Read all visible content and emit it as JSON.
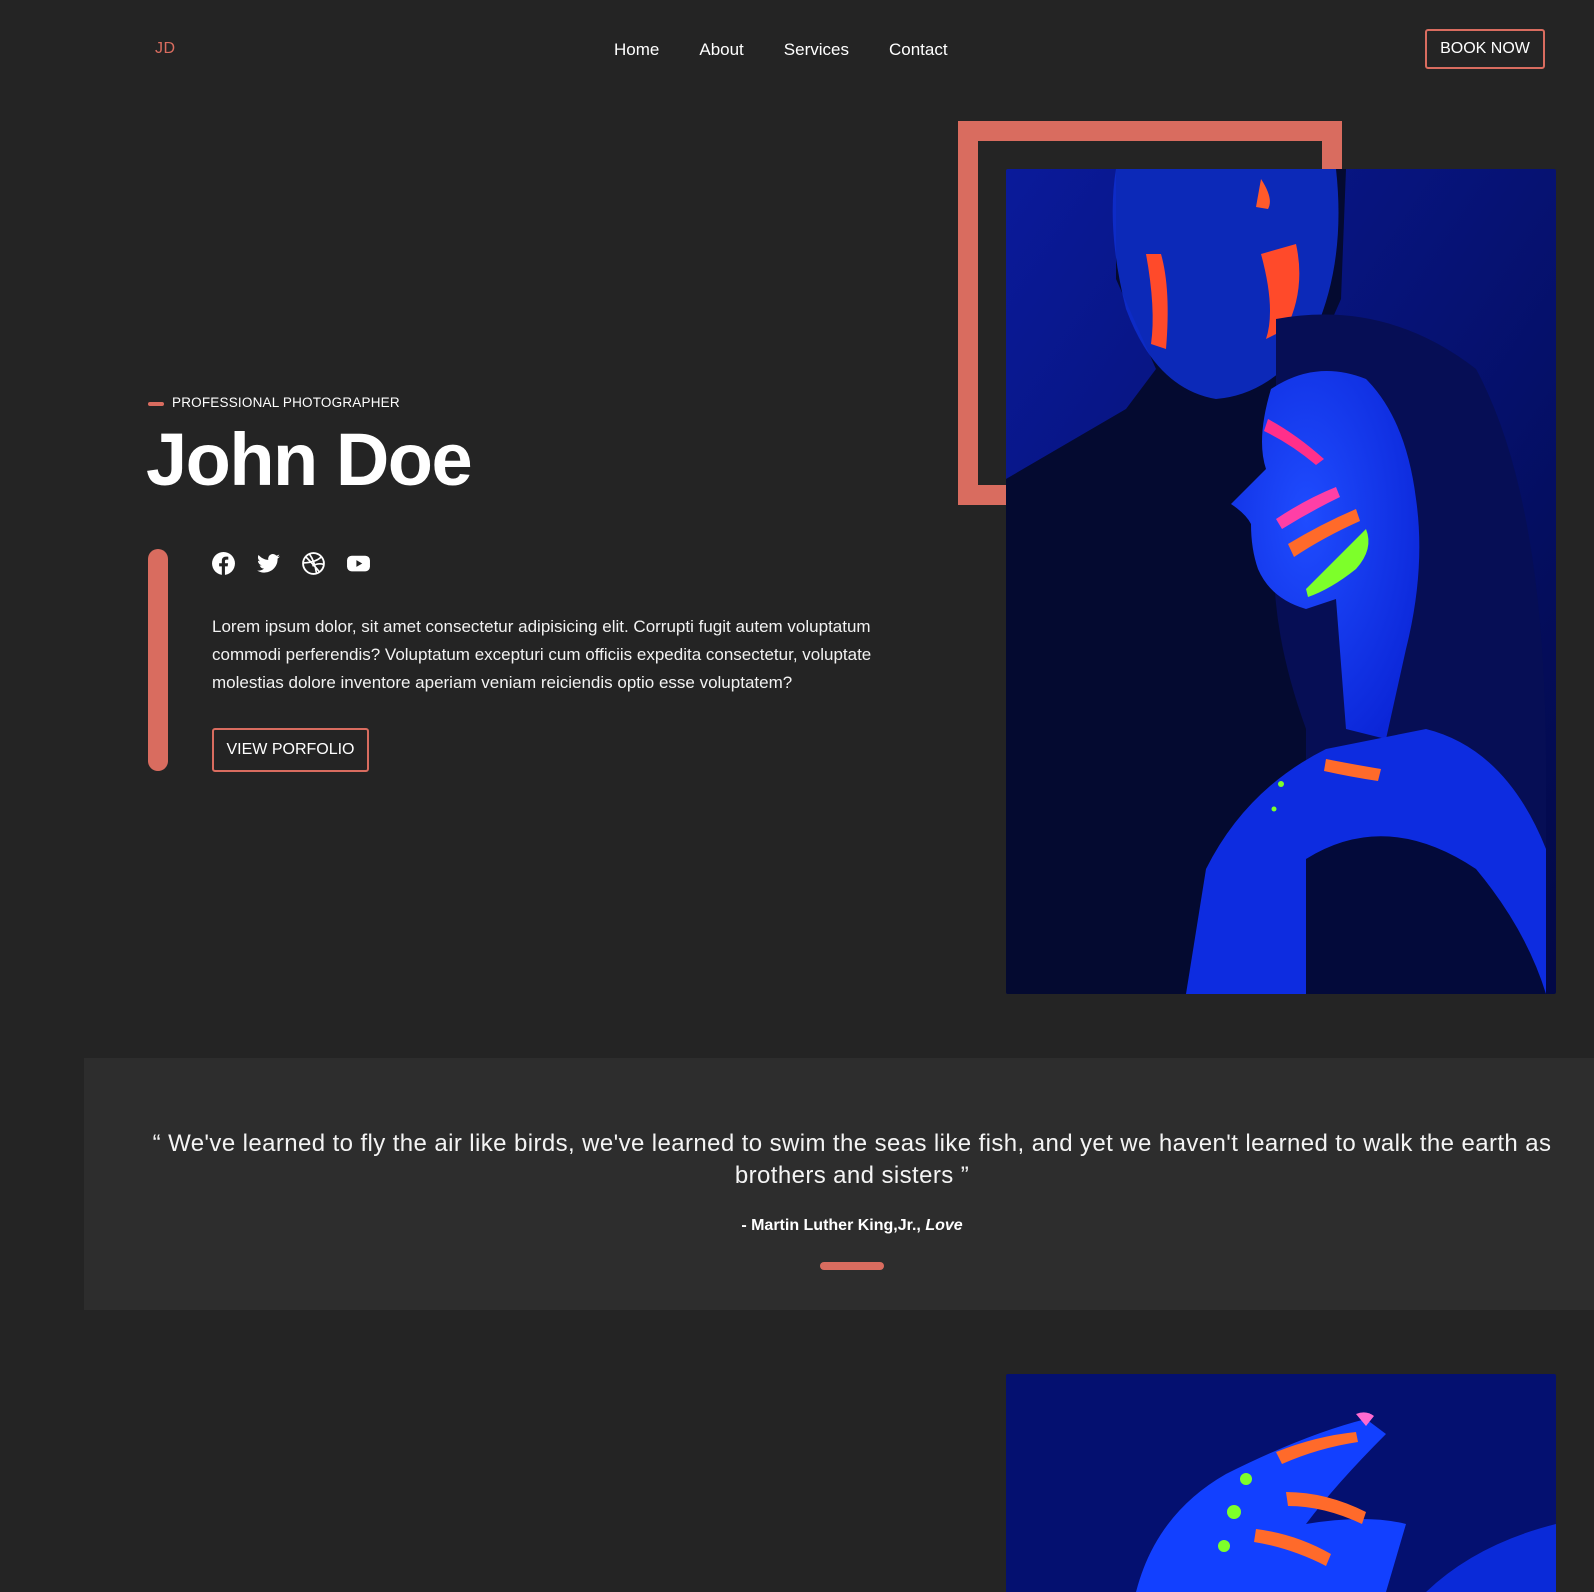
{
  "header": {
    "logo": "JD",
    "nav": [
      "Home",
      "About",
      "Services",
      "Contact"
    ],
    "book_label": "BOOK NOW"
  },
  "hero": {
    "tagline": "PROFESSIONAL PHOTOGRAPHER",
    "name": "John Doe",
    "socials": [
      "facebook-icon",
      "twitter-icon",
      "dribbble-icon",
      "youtube-icon"
    ],
    "bio": "Lorem ipsum dolor, sit amet consectetur adipisicing elit. Corrupti fugit autem voluptatum commodi perferendis? Voluptatum excepturi cum officiis expedita consectetur, voluptate molestias dolore inventore aperiam veniam reiciendis optio esse voluptatem?",
    "portfolio_label": "VIEW PORFOLIO"
  },
  "quote": {
    "text": "“ We've learned to fly the air like birds, we've learned to swim the seas like fish, and yet we haven't learned to walk the earth as brothers and sisters ”",
    "author": "- Martin Luther King,Jr.,",
    "work": "Love"
  },
  "colors": {
    "accent": "#d96c5f",
    "background": "#242424",
    "quote_background": "#2d2d2d"
  }
}
